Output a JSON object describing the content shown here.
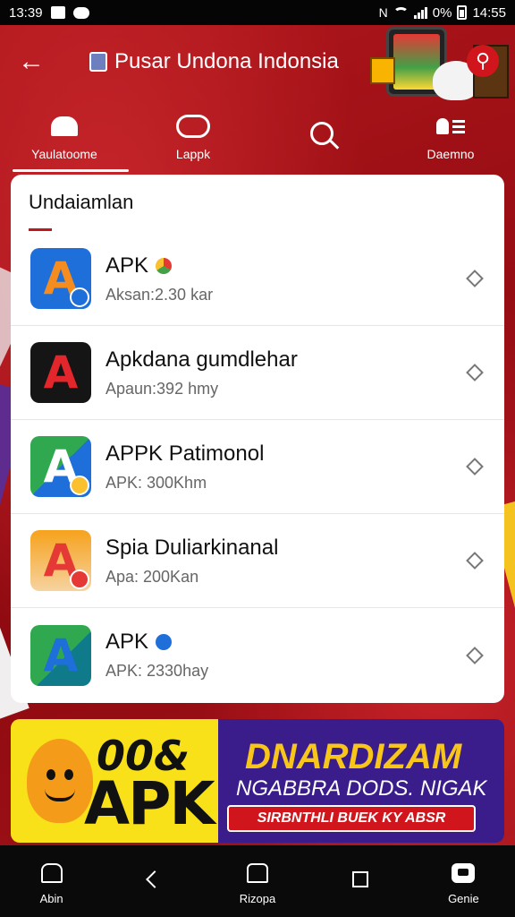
{
  "status_bar": {
    "time": "13:39",
    "battery_text": "0%",
    "clock_right": "14:55"
  },
  "header": {
    "title": "Pusar Undona Indonsia"
  },
  "tabs": [
    {
      "label": "Yaulatoome",
      "icon": "home-icon",
      "active": true
    },
    {
      "label": "Lappk",
      "icon": "chat-icon",
      "active": false
    },
    {
      "label": "",
      "icon": "search-icon",
      "active": false
    },
    {
      "label": "Daemno",
      "icon": "people-icon",
      "active": false
    }
  ],
  "list_card": {
    "title": "Undaiamlan",
    "items": [
      {
        "name": "APK",
        "sub": "Aksan:2.30 kar",
        "logo": "A",
        "badge_color": "#e53935"
      },
      {
        "name": "Apkdana gumdlehar",
        "sub": "Apaun:392 hmy",
        "logo": "A",
        "badge_color": ""
      },
      {
        "name": "APPK Patimonol",
        "sub": "APK: 300Khm",
        "logo": "A",
        "badge_color": ""
      },
      {
        "name": "Spia Duliarkinanal",
        "sub": "Apa: 200Kan",
        "logo": "A",
        "badge_color": ""
      },
      {
        "name": "APK",
        "sub": "APK: 2330hay",
        "logo": "A",
        "badge_color": "#1565c0"
      }
    ]
  },
  "banner": {
    "left_line1": "00&",
    "left_line2": "APK",
    "right_line1": "DNARDIZAM",
    "right_line2": "NGABBRA DODS. NIGAK",
    "cta": "SIRBNTHLI BUEK KY ABSR"
  },
  "bottom_nav": [
    {
      "label": "Abin",
      "icon": "home-icon"
    },
    {
      "label": "",
      "icon": "back-icon"
    },
    {
      "label": "Rizopa",
      "icon": "house-icon"
    },
    {
      "label": "",
      "icon": "square-icon"
    },
    {
      "label": "Genie",
      "icon": "game-icon"
    }
  ],
  "colors": {
    "primary_red": "#b0171c",
    "banner_yellow": "#f8e118",
    "banner_purple": "#3a1d8a"
  }
}
